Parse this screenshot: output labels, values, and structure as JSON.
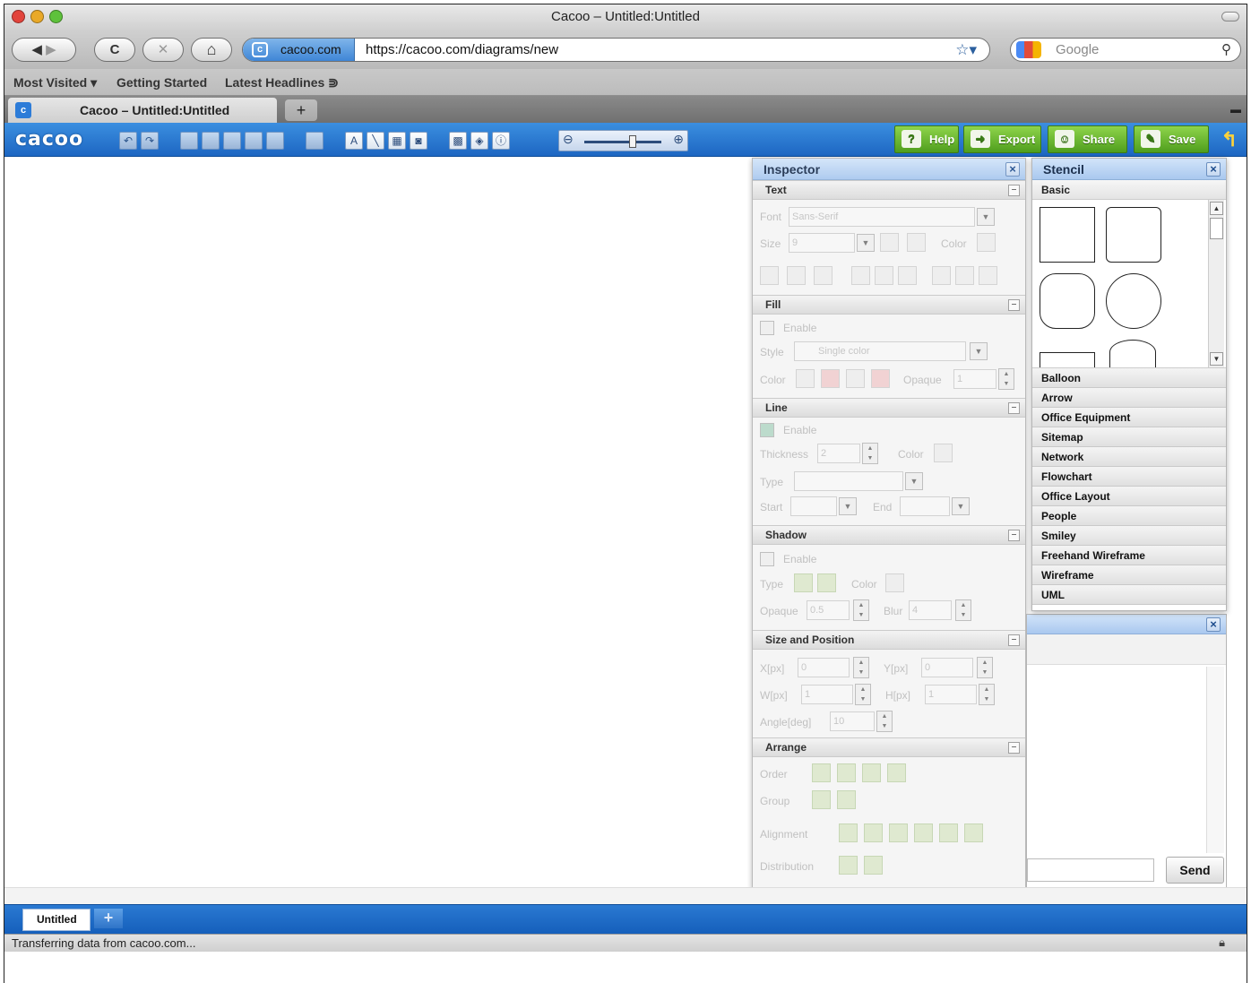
{
  "window": {
    "title": "Cacoo – Untitled:Untitled"
  },
  "nav": {
    "site_identity": "cacoo.com",
    "url": "https://cacoo.com/diagrams/new",
    "search_placeholder": "Google",
    "back": "◀",
    "forward": "▶",
    "reload": "C",
    "stop": "✕",
    "home": "⌂"
  },
  "bookmarks": [
    "Most Visited ▾",
    "Getting Started",
    "Latest Headlines ⋑"
  ],
  "tabs": [
    {
      "label": "Cacoo – Untitled:Untitled"
    }
  ],
  "newtab": "+",
  "cacoo": {
    "logo": "cacoo",
    "buttons": {
      "help": "Help",
      "export": "Export",
      "share": "Share",
      "save": "Save"
    }
  },
  "inspector": {
    "title": "Inspector",
    "text": {
      "title": "Text",
      "font_label": "Font",
      "font_value": "Sans-Serif",
      "size_label": "Size",
      "size_value": "9",
      "color_label": "Color"
    },
    "fill": {
      "title": "Fill",
      "enable": "Enable",
      "style_label": "Style",
      "style_value": "Single color",
      "color_label": "Color",
      "opaque_label": "Opaque",
      "opaque_value": "1"
    },
    "line": {
      "title": "Line",
      "enable": "Enable",
      "thickness_label": "Thickness",
      "thickness_value": "2",
      "color_label": "Color",
      "type_label": "Type",
      "start_label": "Start",
      "end_label": "End"
    },
    "shadow": {
      "title": "Shadow",
      "enable": "Enable",
      "type_label": "Type",
      "color_label": "Color",
      "opaque_label": "Opaque",
      "opaque_value": "0.5",
      "blur_label": "Blur",
      "blur_value": "4"
    },
    "size": {
      "title": "Size and Position",
      "x_label": "X[px]",
      "x_value": "0",
      "y_label": "Y[px]",
      "y_value": "0",
      "w_label": "W[px]",
      "w_value": "1",
      "h_label": "H[px]",
      "h_value": "1",
      "angle_label": "Angle[deg]",
      "angle_value": "10"
    },
    "arrange": {
      "title": "Arrange",
      "order_label": "Order",
      "group_label": "Group",
      "alignment_label": "Alignment",
      "distribution_label": "Distribution"
    }
  },
  "stencil": {
    "title": "Stencil",
    "basic": "Basic",
    "categories": [
      "Balloon",
      "Arrow",
      "Office Equipment",
      "Sitemap",
      "Network",
      "Flowchart",
      "Office Layout",
      "People",
      "Smiley",
      "Freehand Wireframe",
      "Wireframe",
      "UML"
    ]
  },
  "chat": {
    "send": "Send"
  },
  "pages": {
    "tab": "Untitled",
    "add": "+"
  },
  "status": {
    "text": "Transferring data from cacoo.com..."
  },
  "colors": {
    "cacoo_blue": "#1d66c2",
    "green_button": "#4f9e1d"
  }
}
